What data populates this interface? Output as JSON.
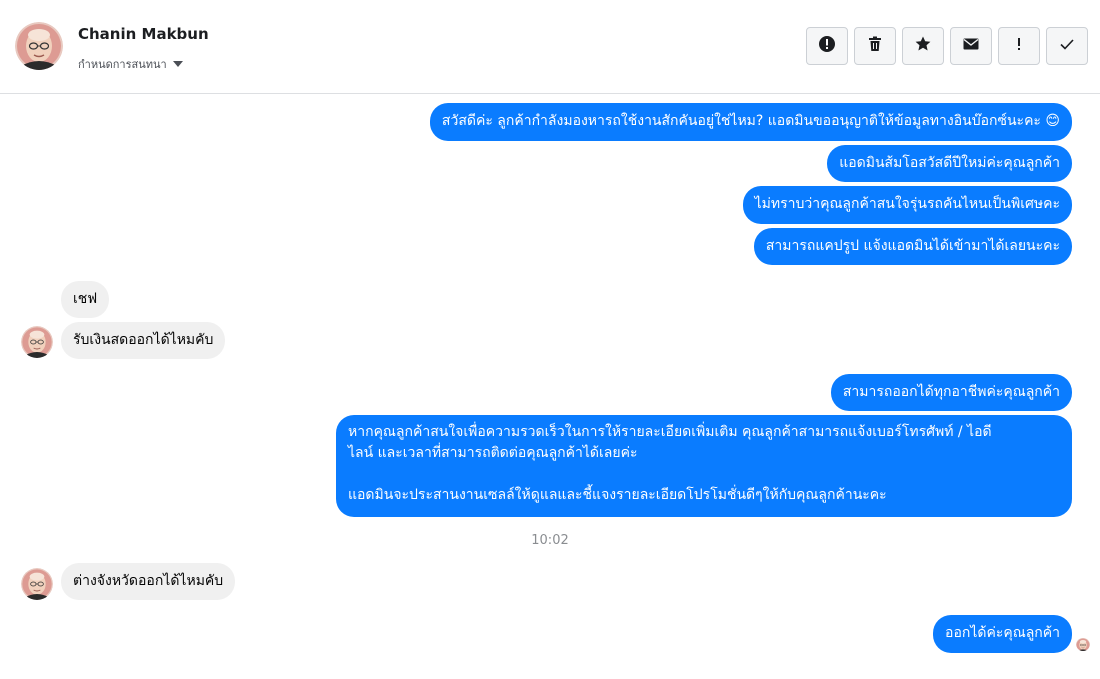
{
  "header": {
    "contact_name": "Chanin Makbun",
    "conversation_setting": "กำหนดการสนทนา",
    "toolbar": [
      {
        "icon": "alert-icon"
      },
      {
        "icon": "trash-icon"
      },
      {
        "icon": "star-icon"
      },
      {
        "icon": "envelope-icon"
      },
      {
        "icon": "exclamation-icon"
      },
      {
        "icon": "checkmark-icon"
      }
    ]
  },
  "messages": {
    "out1": "สวัสดีค่ะ ลูกค้ากำลังมองหารถใช้งานสักคันอยู่ใช่ไหม? แอดมินขออนุญาติให้ข้อมูลทางอินบ๊อกซ์นะคะ 😊",
    "out2": "แอดมินส้มโอสวัสดีปีใหม่ค่ะคุณลูกค้า",
    "out3": "ไม่ทราบว่าคุณลูกค้าสนใจรุ่นรถคันไหนเป็นพิเศษคะ",
    "out4": "สามารถแคปรูป แจ้งแอดมินได้เข้ามาได้เลยนะคะ",
    "in1": "เชฟ",
    "in2": "รับเงินสดออกได้ไหมคับ",
    "out5": "สามารถออกได้ทุกอาชีพค่ะคุณลูกค้า",
    "out6_line1": "หากคุณลูกค้าสนใจเพื่อความรวดเร็วในการให้รายละเอียดเพิ่มเติม คุณลูกค้าสามารถแจ้งเบอร์โทรศัพท์ / ไอดี",
    "out6_line2": "ไลน์ และเวลาที่สามารถติดต่อคุณลูกค้าได้เลยค่ะ",
    "out6_line3": "แอดมินจะประสานงานเซลล์ให้ดูแลและชี้แจงรายละเอียดโปรโมชั่นดีๆให้กับคุณลูกค้านะคะ",
    "timestamp": "10:02",
    "in3": "ต่างจังหวัดออกได้ไหมคับ",
    "out7": "ออกได้ค่ะคุณลูกค้า"
  },
  "colors": {
    "outgoing_bubble": "#0a7cff",
    "incoming_bubble": "#f0f0f0",
    "timestamp": "#8a8d91"
  }
}
